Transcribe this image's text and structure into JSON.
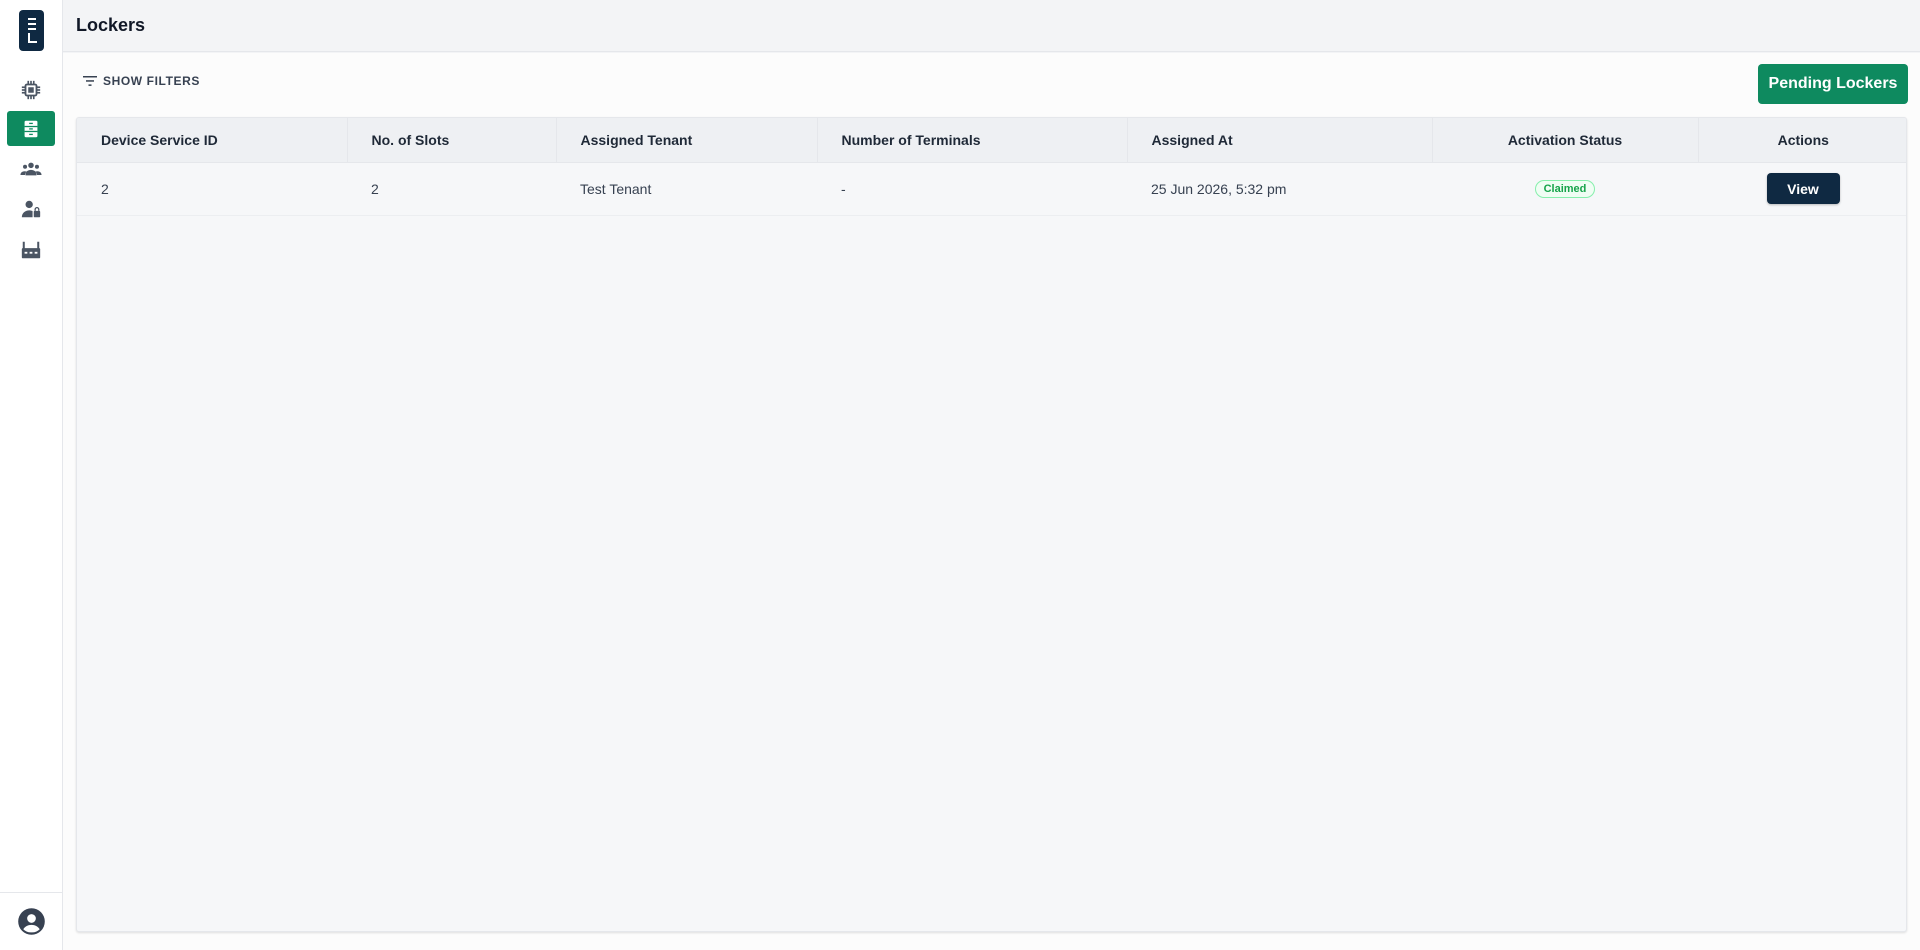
{
  "app": {
    "logo_letter": "L",
    "accent_color": "#0e8a5f",
    "brand_dark": "#0f2942"
  },
  "sidebar": {
    "items": [
      {
        "icon": "chip-icon",
        "active": false
      },
      {
        "icon": "lockers-icon",
        "active": true
      },
      {
        "icon": "users-group-icon",
        "active": false
      },
      {
        "icon": "user-badge-icon",
        "active": false
      },
      {
        "icon": "factory-icon",
        "active": false
      }
    ],
    "profile_icon": "account-circle-icon"
  },
  "header": {
    "title": "Lockers"
  },
  "toolbar": {
    "filters_label": "SHOW FILTERS",
    "pending_label": "Pending Lockers"
  },
  "table": {
    "columns": [
      "Device Service ID",
      "No. of Slots",
      "Assigned Tenant",
      "Number of Terminals",
      "Assigned At",
      "Activation Status",
      "Actions"
    ],
    "rows": [
      {
        "device_service_id": "2",
        "slots": "2",
        "tenant": "Test Tenant",
        "terminals": "-",
        "assigned_at": "25 Jun 2026, 5:32 pm",
        "status": "Claimed",
        "action": "View"
      }
    ]
  }
}
